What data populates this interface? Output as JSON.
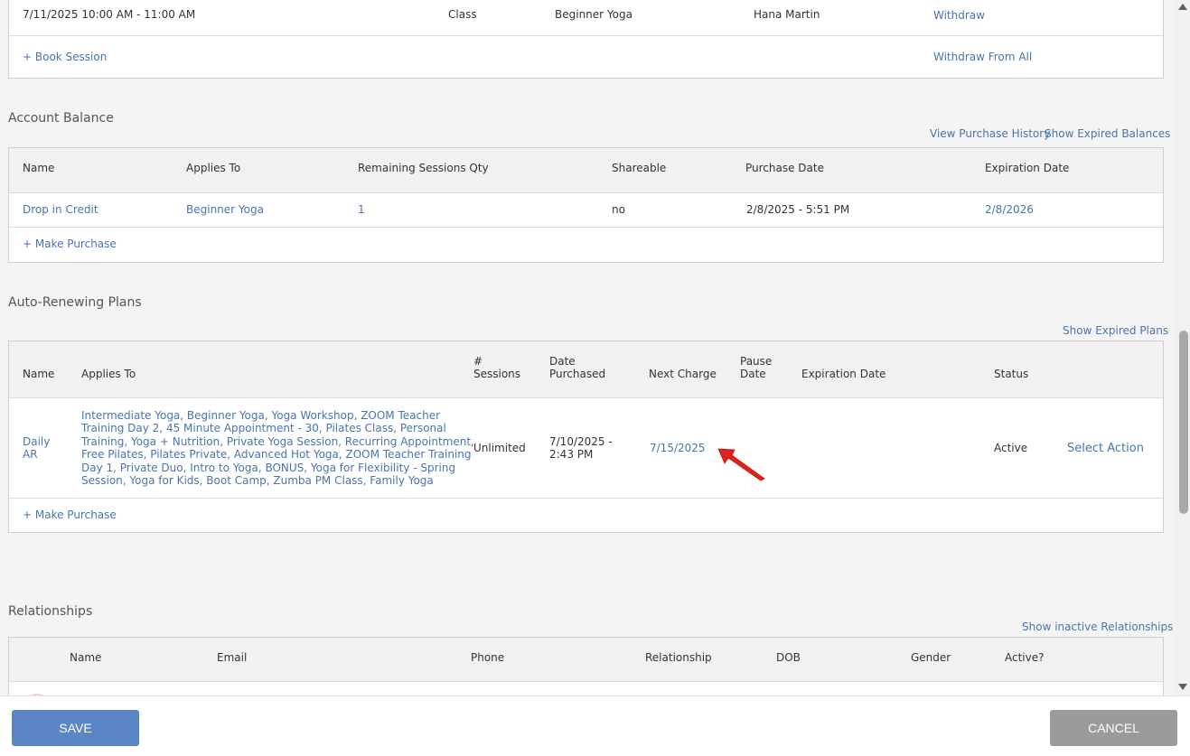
{
  "sessions": {
    "row": {
      "datetime": "7/11/2025 10:00 AM - 11:00 AM",
      "type": "Class",
      "service": "Beginner Yoga",
      "staff": "Hana Martin",
      "action": "Withdraw"
    },
    "book_label": "+ Book Session",
    "withdraw_all_label": "Withdraw From All"
  },
  "account_balance": {
    "title": "Account Balance",
    "view_history": "View Purchase History",
    "show_expired": "Show Expired Balances",
    "headers": [
      "Name",
      "Applies To",
      "Remaining Sessions Qty",
      "Shareable",
      "Purchase Date",
      "Expiration Date"
    ],
    "row": {
      "name": "Drop in Credit",
      "applies_to": "Beginner Yoga",
      "remaining": "1",
      "shareable": "no",
      "purchase_date": "2/8/2025 - 5:51 PM",
      "expiration": "2/8/2026"
    },
    "make_purchase": "+ Make Purchase"
  },
  "auto_renew": {
    "title": "Auto-Renewing Plans",
    "show_expired": "Show Expired Plans",
    "headers": {
      "name": "Name",
      "applies_to": "Applies To",
      "sessions_a": "#",
      "sessions_b": "Sessions",
      "date_a": "Date",
      "date_b": "Purchased",
      "next_charge": "Next Charge",
      "pause_a": "Pause",
      "pause_b": "Date",
      "expiration": "Expiration Date",
      "status": "Status"
    },
    "row": {
      "name_a": "Daily",
      "name_b": "AR",
      "applies_lines": [
        "Intermediate Yoga, Beginner Yoga, Yoga Workshop, ZOOM Teacher",
        "Training Day 2, 45 Minute Appointment - 30, Pilates Class, Personal",
        "Training, Yoga + Nutrition, Private Yoga Session, Recurring Appointment,",
        "Free Pilates, Pilates Private, Advanced Hot Yoga, ZOOM Teacher Training",
        "Day 1, Private Duo, Intro to Yoga, BONUS, Yoga for Flexibility - Spring",
        "Session, Yoga for Kids, Boot Camp, Zumba PM Class, Family Yoga"
      ],
      "sessions": "Unlimited",
      "date_a": "7/10/2025 -",
      "date_b": "2:43 PM",
      "next_charge": "7/15/2025",
      "status": "Active",
      "action": "Select Action"
    },
    "make_purchase": "+ Make Purchase"
  },
  "relationships": {
    "title": "Relationships",
    "show_inactive": "Show inactive Relationships",
    "headers": [
      "Name",
      "Email",
      "Phone",
      "Relationship",
      "DOB",
      "Gender",
      "Active?"
    ]
  },
  "footer": {
    "save": "SAVE",
    "cancel": "CANCEL"
  },
  "colors": {
    "link": "#4a74ad",
    "save": "#5b85c4",
    "cancel": "#9b9b9b",
    "annotation_arrow": "#e3211b"
  }
}
